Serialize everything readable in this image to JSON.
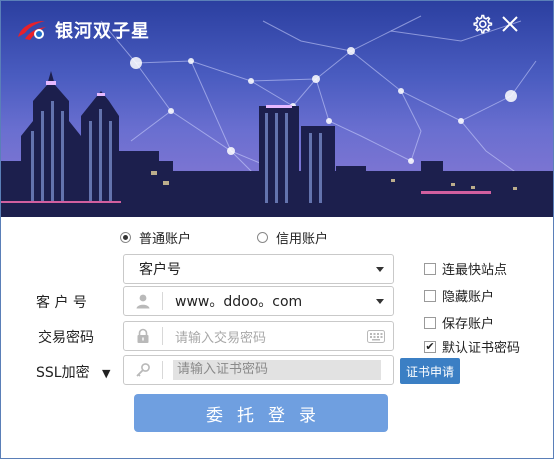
{
  "app": {
    "title": "银河双子星"
  },
  "window_controls": {
    "settings_icon": "gear-icon",
    "close_icon": "close-icon"
  },
  "account_type": {
    "options": [
      {
        "label": "普通账户",
        "selected": true
      },
      {
        "label": "信用账户",
        "selected": false
      }
    ]
  },
  "login_type": {
    "selected": "客户号"
  },
  "customer": {
    "label": "客 户 号",
    "value": "www。ddoo。com"
  },
  "password": {
    "label": "交易密码",
    "placeholder": "请输入交易密码",
    "keyboard_icon": "keyboard-icon"
  },
  "ssl": {
    "label": "SSL加密",
    "placeholder": "请输入证书密码",
    "apply_button": "证书申请"
  },
  "options": [
    {
      "label": "连最快站点",
      "checked": false
    },
    {
      "label": "隐藏账户",
      "checked": false
    },
    {
      "label": "保存账户",
      "checked": false
    },
    {
      "label": "默认证书密码",
      "checked": true
    }
  ],
  "submit": {
    "label": "委托登录"
  },
  "colors": {
    "primary_button": "#6f9fe0",
    "cert_button": "#3b7fc4",
    "banner_top": "#2b3fa0"
  }
}
